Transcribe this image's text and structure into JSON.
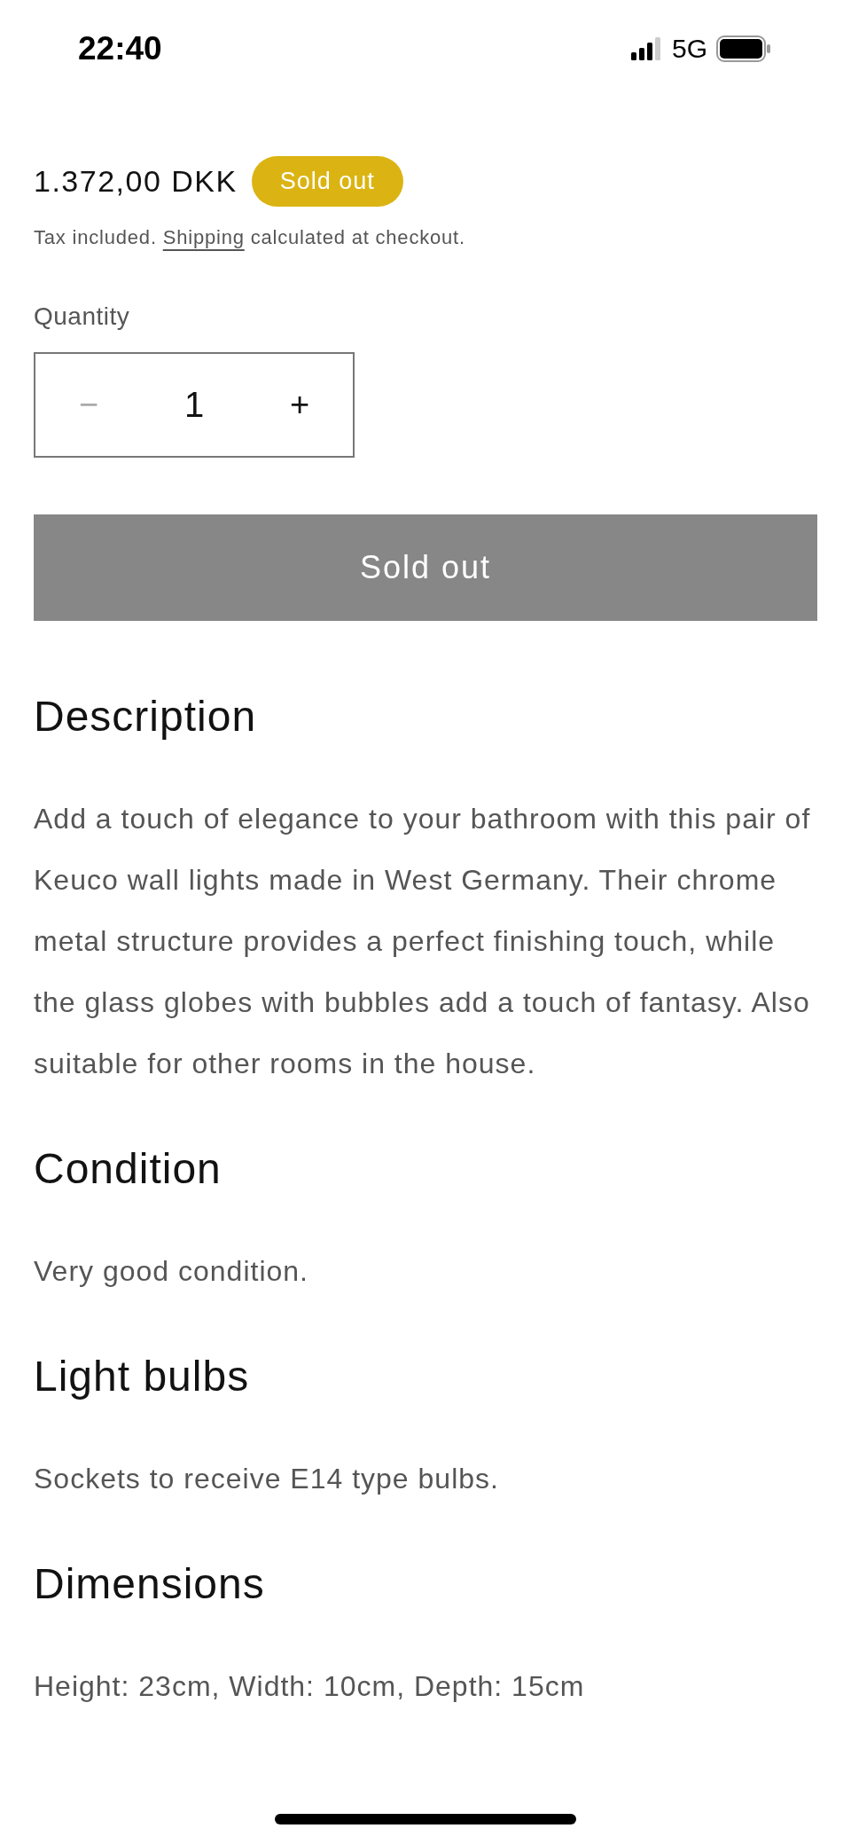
{
  "status_bar": {
    "time": "22:40",
    "network": "5G"
  },
  "product": {
    "price": "1.372,00 DKK",
    "badge": "Sold out",
    "tax_note": {
      "before": "Tax included. ",
      "link": "Shipping",
      "after": " calculated at checkout."
    },
    "quantity": {
      "label": "Quantity",
      "decrease": "−",
      "value": "1",
      "increase": "+",
      "decrease_disabled": true
    },
    "add_button": {
      "label": "Sold out",
      "disabled": true
    }
  },
  "sections": [
    {
      "heading": "Description",
      "text": "Add a touch of elegance to your bathroom with this pair of Keuco wall lights made in West Germany. Their chrome metal structure provides a perfect finishing touch, while the glass globes with bubbles add a touch of fantasy. Also suitable for other rooms in the house."
    },
    {
      "heading": "Condition",
      "text": "Very good condition."
    },
    {
      "heading": "Light bulbs",
      "text": "Sockets to receive E14 type bulbs."
    },
    {
      "heading": "Dimensions",
      "text": "Height: 23cm, Width: 10cm, Depth: 15cm"
    }
  ]
}
